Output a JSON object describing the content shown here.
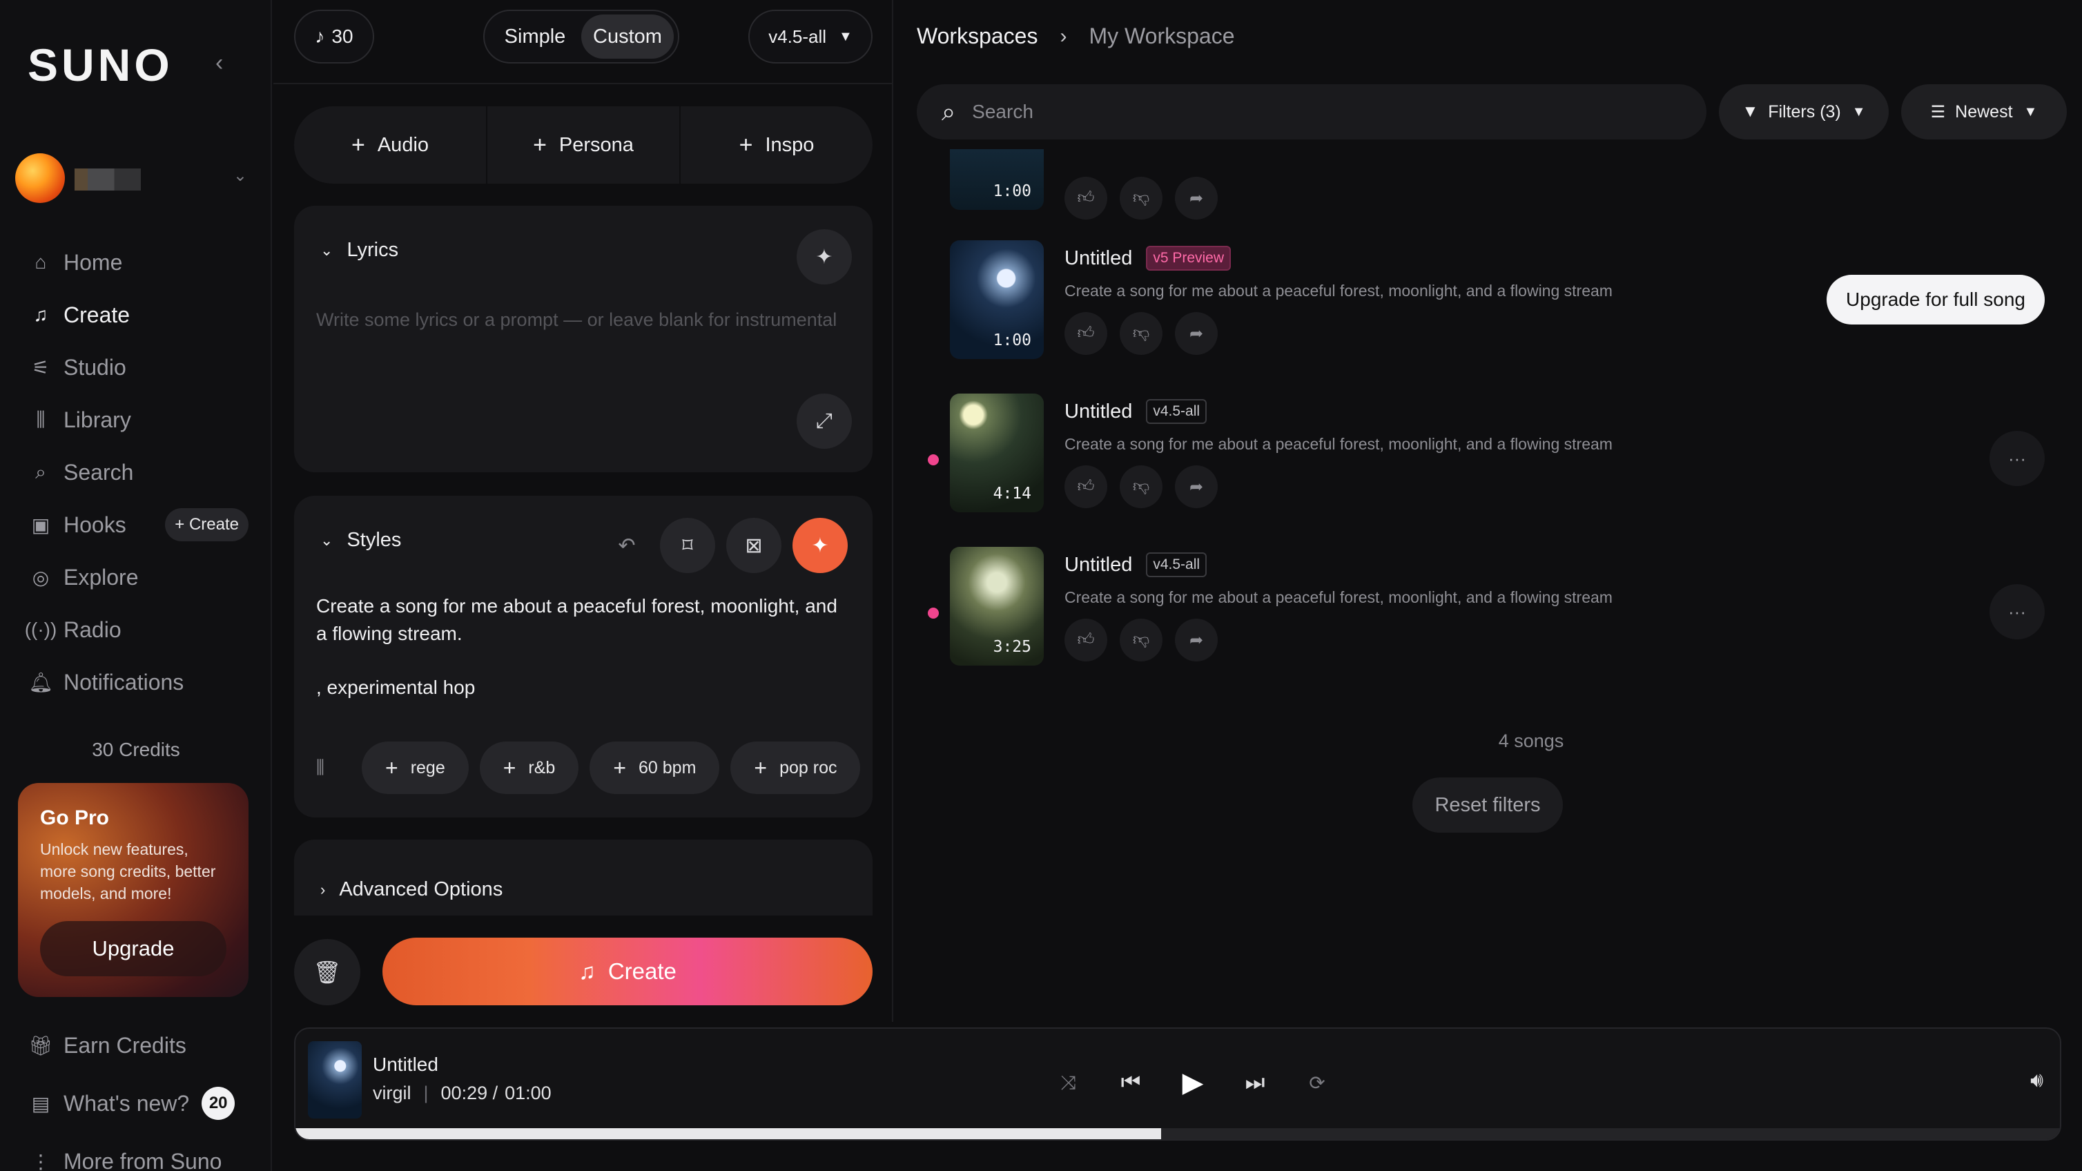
{
  "app": {
    "logo": "SUNO"
  },
  "sidebar": {
    "nav": [
      {
        "label": "Home",
        "icon": "home-icon",
        "active": false
      },
      {
        "label": "Create",
        "icon": "create-music-icon",
        "active": true
      },
      {
        "label": "Studio",
        "icon": "studio-icon",
        "active": false
      },
      {
        "label": "Library",
        "icon": "library-icon",
        "active": false
      },
      {
        "label": "Search",
        "icon": "search-icon",
        "active": false
      },
      {
        "label": "Hooks",
        "icon": "hooks-icon",
        "active": false
      },
      {
        "label": "Explore",
        "icon": "explore-icon",
        "active": false
      },
      {
        "label": "Radio",
        "icon": "radio-icon",
        "active": false
      },
      {
        "label": "Notifications",
        "icon": "bell-icon",
        "active": false
      }
    ],
    "hooks_create": "+ Create",
    "credits": "30 Credits",
    "gopro": {
      "title": "Go Pro",
      "text": "Unlock new features, more song credits, better models, and more!",
      "button": "Upgrade"
    },
    "bottom": [
      {
        "label": "Earn Credits",
        "icon": "gift-icon"
      },
      {
        "label": "What's new?",
        "icon": "news-icon",
        "badge": "20"
      },
      {
        "label": "More from Suno",
        "icon": "more-vertical-icon"
      }
    ]
  },
  "create": {
    "credits": "30",
    "modes": [
      "Simple",
      "Custom"
    ],
    "active_mode": "Custom",
    "version": "v4.5-all",
    "add_buttons": [
      "Audio",
      "Persona",
      "Inspo"
    ],
    "lyrics": {
      "label": "Lyrics",
      "placeholder": "Write some lyrics or a prompt — or leave blank for instrumental"
    },
    "styles": {
      "label": "Styles",
      "text": "Create a song for me about a peaceful forest, moonlight, and a flowing stream.",
      "text2": ", experimental hop",
      "tags": [
        "rege",
        "r&b",
        "60 bpm",
        "pop roc"
      ]
    },
    "advanced": "Advanced Options",
    "create_button": "Create"
  },
  "library": {
    "breadcrumb": [
      "Workspaces",
      "My Workspace"
    ],
    "search_placeholder": "Search",
    "filters": "Filters (3)",
    "sort": "Newest",
    "songs": [
      {
        "duration": "1:00"
      },
      {
        "title": "Untitled",
        "version": "v5 Preview",
        "description": "Create a song for me about a peaceful forest, moonlight, and a flowing stream",
        "duration": "1:00",
        "upgrade": "Upgrade for full song"
      },
      {
        "title": "Untitled",
        "version": "v4.5-all",
        "description": "Create a song for me about a peaceful forest, moonlight, and a flowing stream",
        "duration": "4:14"
      },
      {
        "title": "Untitled",
        "version": "v4.5-all",
        "description": "Create a song for me about a peaceful forest, moonlight, and a flowing stream",
        "duration": "3:25"
      }
    ],
    "count": "4 songs",
    "reset": "Reset filters"
  },
  "player": {
    "title": "Untitled",
    "artist": "virgil",
    "current": "00:29 /",
    "total": "01:00",
    "progress": 0.49
  },
  "colors": {
    "accent": "#f0603a",
    "pink_dot": "#f0458e",
    "preview_tag": "#ff6aa8"
  }
}
